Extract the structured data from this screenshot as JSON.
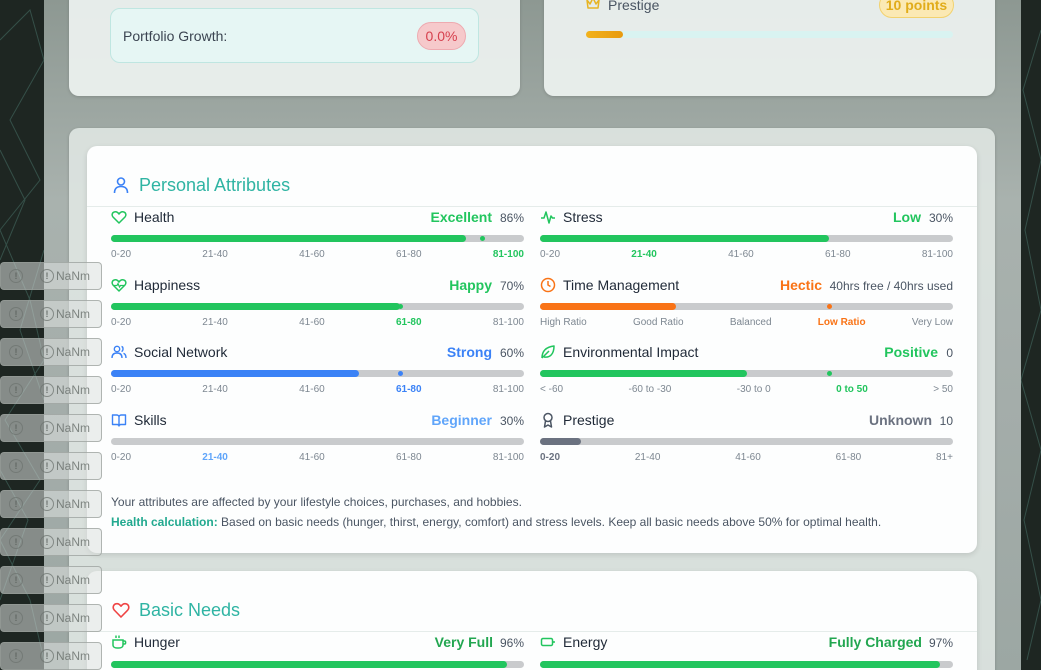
{
  "portfolio": {
    "label": "Portfolio Growth:",
    "value": "0.0%"
  },
  "prestige_top": {
    "label": "Prestige",
    "badge": "10 points",
    "progress": 0.1
  },
  "personal_attributes": {
    "title": "Personal Attributes",
    "attributes": [
      {
        "name": "Health",
        "status": "Excellent",
        "value": "86%",
        "progress": 0.86,
        "color": "#22c55e",
        "ticks": [
          "0-20",
          "21-40",
          "41-60",
          "61-80",
          "81-100"
        ],
        "active": 4
      },
      {
        "name": "Stress",
        "status": "Low",
        "value": "30%",
        "progress": 0.7,
        "color": "#22c55e",
        "ticks": [
          "0-20",
          "21-40",
          "41-60",
          "61-80",
          "81-100"
        ],
        "active": 1
      },
      {
        "name": "Happiness",
        "status": "Happy",
        "value": "70%",
        "progress": 0.7,
        "color": "#22c55e",
        "ticks": [
          "0-20",
          "21-40",
          "41-60",
          "61-80",
          "81-100"
        ],
        "active": 3
      },
      {
        "name": "Time Management",
        "status": "Hectic",
        "value": "40hrs free / 40hrs used",
        "progress": 0.33,
        "color": "#f97316",
        "ticks": [
          "High Ratio",
          "Good Ratio",
          "Balanced",
          "Low Ratio",
          "Very Low"
        ],
        "active": 3
      },
      {
        "name": "Social Network",
        "status": "Strong",
        "value": "60%",
        "progress": 0.6,
        "color": "#3b82f6",
        "ticks": [
          "0-20",
          "21-40",
          "41-60",
          "61-80",
          "81-100"
        ],
        "active": 3
      },
      {
        "name": "Environmental Impact",
        "status": "Positive",
        "value": "0",
        "progress": 0.5,
        "color": "#22c55e",
        "ticks": [
          "< -60",
          "-60 to -30",
          "-30 to 0",
          "0 to 50",
          "> 50"
        ],
        "active": 3
      },
      {
        "name": "Skills",
        "status": "Beginner",
        "value": "30%",
        "progress": 0.0,
        "color": "#60a5fa",
        "ticks": [
          "0-20",
          "21-40",
          "41-60",
          "61-80",
          "81-100"
        ],
        "active": 1
      },
      {
        "name": "Prestige",
        "status": "Unknown",
        "value": "10",
        "progress": 0.1,
        "color": "#6b7280",
        "ticks": [
          "0-20",
          "21-40",
          "41-60",
          "61-80",
          "81+"
        ],
        "active": 0
      }
    ],
    "note_line1": "Your attributes are affected by your lifestyle choices, purchases, and hobbies.",
    "note_label": "Health calculation:",
    "note_line2": " Based on basic needs (hunger, thirst, energy, comfort) and stress levels. Keep all basic needs above 50% for optimal health."
  },
  "basic_needs": {
    "title": "Basic Needs",
    "needs": [
      {
        "name": "Hunger",
        "status": "Very Full",
        "value": "96%"
      },
      {
        "name": "Energy",
        "status": "Fully Charged",
        "value": "97%"
      }
    ]
  },
  "side_buttons": {
    "label": "NaNm",
    "count": 11
  }
}
